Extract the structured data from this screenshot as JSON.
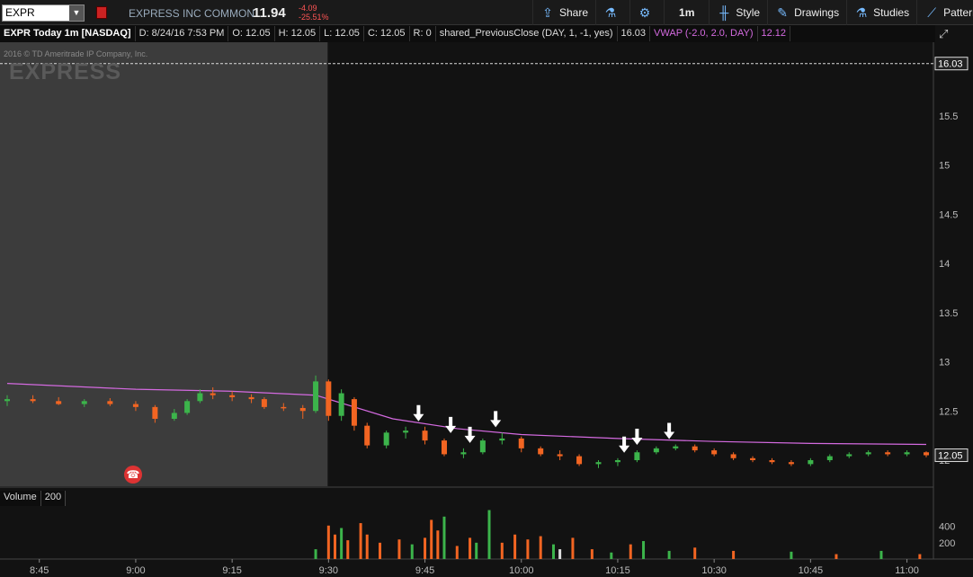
{
  "toolbar": {
    "symbol": "EXPR",
    "description": "EXPRESS INC COMMON",
    "last": "11.94",
    "net_change": "-4.09",
    "pct_change": "-25.51%",
    "buttons": [
      "Share",
      "",
      "1m",
      "Style",
      "Drawings",
      "Studies",
      "Patterns"
    ]
  },
  "infobar": {
    "title": "EXPR Today 1m [NASDAQ]",
    "date": "D: 8/24/16 7:53 PM",
    "open": "O: 12.05",
    "high": "H: 12.05",
    "low": "L: 12.05",
    "close": "C: 12.05",
    "r": "R: 0",
    "prev_close_study": "shared_PreviousClose (DAY, 1, -1, yes)",
    "prev_close_value": "16.03",
    "vwap_study": "VWAP (-2.0, 2.0, DAY)",
    "vwap_value": "12.12"
  },
  "copyright": "2016 © TD Ameritrade IP Company, Inc.",
  "watermark": "EXPRESS",
  "volume": {
    "label": "Volume",
    "value": "200"
  },
  "colors": {
    "up": "#3cb44b",
    "down": "#f26522",
    "vwap": "#d46ae0",
    "premarket_bg": "#3c3c3c",
    "bg": "#121212"
  },
  "chart_data": {
    "type": "candlestick",
    "x_ticks": [
      "8:45",
      "9:00",
      "9:15",
      "9:30",
      "9:45",
      "10:00",
      "10:15",
      "10:30",
      "10:45",
      "11:00"
    ],
    "y_ticks": [
      12,
      12.5,
      13,
      13.5,
      14,
      14.5,
      15,
      15.5,
      16
    ],
    "price_labels": {
      "prev_close": "16.03",
      "last": "12.05"
    },
    "volume_ticks": [
      200,
      400
    ],
    "candles": [
      {
        "t": "8:40",
        "o": 12.6,
        "h": 12.66,
        "l": 12.55,
        "c": 12.62
      },
      {
        "t": "8:44",
        "o": 12.62,
        "h": 12.66,
        "l": 12.58,
        "c": 12.6
      },
      {
        "t": "8:48",
        "o": 12.6,
        "h": 12.64,
        "l": 12.56,
        "c": 12.57
      },
      {
        "t": "8:52",
        "o": 12.57,
        "h": 12.62,
        "l": 12.54,
        "c": 12.6
      },
      {
        "t": "8:56",
        "o": 12.6,
        "h": 12.63,
        "l": 12.55,
        "c": 12.57
      },
      {
        "t": "9:00",
        "o": 12.57,
        "h": 12.6,
        "l": 12.5,
        "c": 12.54
      },
      {
        "t": "9:03",
        "o": 12.54,
        "h": 12.56,
        "l": 12.38,
        "c": 12.42
      },
      {
        "t": "9:06",
        "o": 12.42,
        "h": 12.52,
        "l": 12.4,
        "c": 12.48
      },
      {
        "t": "9:08",
        "o": 12.48,
        "h": 12.62,
        "l": 12.46,
        "c": 12.6
      },
      {
        "t": "9:10",
        "o": 12.6,
        "h": 12.72,
        "l": 12.58,
        "c": 12.68
      },
      {
        "t": "9:12",
        "o": 12.68,
        "h": 12.74,
        "l": 12.62,
        "c": 12.66
      },
      {
        "t": "9:15",
        "o": 12.66,
        "h": 12.7,
        "l": 12.6,
        "c": 12.64
      },
      {
        "t": "9:18",
        "o": 12.64,
        "h": 12.67,
        "l": 12.58,
        "c": 12.62
      },
      {
        "t": "9:20",
        "o": 12.62,
        "h": 12.64,
        "l": 12.52,
        "c": 12.54
      },
      {
        "t": "9:23",
        "o": 12.54,
        "h": 12.58,
        "l": 12.5,
        "c": 12.53
      },
      {
        "t": "9:26",
        "o": 12.53,
        "h": 12.56,
        "l": 12.42,
        "c": 12.5
      },
      {
        "t": "9:28",
        "o": 12.5,
        "h": 12.86,
        "l": 12.48,
        "c": 12.8
      },
      {
        "t": "9:30",
        "o": 12.8,
        "h": 12.82,
        "l": 12.4,
        "c": 12.45
      },
      {
        "t": "9:32",
        "o": 12.45,
        "h": 12.72,
        "l": 12.4,
        "c": 12.68
      },
      {
        "t": "9:34",
        "o": 12.62,
        "h": 12.64,
        "l": 12.3,
        "c": 12.35
      },
      {
        "t": "9:36",
        "o": 12.35,
        "h": 12.38,
        "l": 12.12,
        "c": 12.15
      },
      {
        "t": "9:39",
        "o": 12.15,
        "h": 12.3,
        "l": 12.12,
        "c": 12.28
      },
      {
        "t": "9:42",
        "o": 12.28,
        "h": 12.34,
        "l": 12.22,
        "c": 12.3
      },
      {
        "t": "9:45",
        "o": 12.3,
        "h": 12.34,
        "l": 12.16,
        "c": 12.2
      },
      {
        "t": "9:48",
        "o": 12.2,
        "h": 12.22,
        "l": 12.04,
        "c": 12.06
      },
      {
        "t": "9:51",
        "o": 12.06,
        "h": 12.12,
        "l": 12.02,
        "c": 12.08
      },
      {
        "t": "9:54",
        "o": 12.08,
        "h": 12.22,
        "l": 12.06,
        "c": 12.2
      },
      {
        "t": "9:57",
        "o": 12.2,
        "h": 12.28,
        "l": 12.16,
        "c": 12.22
      },
      {
        "t": "10:00",
        "o": 12.22,
        "h": 12.24,
        "l": 12.08,
        "c": 12.12
      },
      {
        "t": "10:03",
        "o": 12.12,
        "h": 12.14,
        "l": 12.04,
        "c": 12.06
      },
      {
        "t": "10:06",
        "o": 12.06,
        "h": 12.1,
        "l": 12.0,
        "c": 12.04
      },
      {
        "t": "10:09",
        "o": 12.04,
        "h": 12.06,
        "l": 11.94,
        "c": 11.96
      },
      {
        "t": "10:12",
        "o": 11.96,
        "h": 12.0,
        "l": 11.92,
        "c": 11.98
      },
      {
        "t": "10:15",
        "o": 11.98,
        "h": 12.02,
        "l": 11.94,
        "c": 12.0
      },
      {
        "t": "10:18",
        "o": 12.0,
        "h": 12.1,
        "l": 11.98,
        "c": 12.08
      },
      {
        "t": "10:21",
        "o": 12.08,
        "h": 12.14,
        "l": 12.06,
        "c": 12.12
      },
      {
        "t": "10:24",
        "o": 12.12,
        "h": 12.16,
        "l": 12.1,
        "c": 12.14
      },
      {
        "t": "10:27",
        "o": 12.14,
        "h": 12.16,
        "l": 12.08,
        "c": 12.1
      },
      {
        "t": "10:30",
        "o": 12.1,
        "h": 12.12,
        "l": 12.04,
        "c": 12.06
      },
      {
        "t": "10:33",
        "o": 12.06,
        "h": 12.08,
        "l": 12.0,
        "c": 12.02
      },
      {
        "t": "10:36",
        "o": 12.02,
        "h": 12.04,
        "l": 11.98,
        "c": 12.0
      },
      {
        "t": "10:39",
        "o": 12.0,
        "h": 12.02,
        "l": 11.96,
        "c": 11.98
      },
      {
        "t": "10:42",
        "o": 11.98,
        "h": 12.0,
        "l": 11.94,
        "c": 11.96
      },
      {
        "t": "10:45",
        "o": 11.96,
        "h": 12.02,
        "l": 11.94,
        "c": 12.0
      },
      {
        "t": "10:48",
        "o": 12.0,
        "h": 12.06,
        "l": 11.98,
        "c": 12.04
      },
      {
        "t": "10:51",
        "o": 12.04,
        "h": 12.08,
        "l": 12.02,
        "c": 12.06
      },
      {
        "t": "10:54",
        "o": 12.06,
        "h": 12.1,
        "l": 12.04,
        "c": 12.08
      },
      {
        "t": "10:57",
        "o": 12.08,
        "h": 12.1,
        "l": 12.04,
        "c": 12.06
      },
      {
        "t": "11:00",
        "o": 12.06,
        "h": 12.1,
        "l": 12.04,
        "c": 12.08
      },
      {
        "t": "11:03",
        "o": 12.08,
        "h": 12.09,
        "l": 12.03,
        "c": 12.05
      }
    ],
    "vwap": [
      {
        "t": "8:40",
        "v": 12.78
      },
      {
        "t": "9:00",
        "v": 12.72
      },
      {
        "t": "9:15",
        "v": 12.7
      },
      {
        "t": "9:28",
        "v": 12.66
      },
      {
        "t": "9:32",
        "v": 12.58
      },
      {
        "t": "9:40",
        "v": 12.42
      },
      {
        "t": "9:50",
        "v": 12.32
      },
      {
        "t": "10:00",
        "v": 12.26
      },
      {
        "t": "10:15",
        "v": 12.22
      },
      {
        "t": "10:30",
        "v": 12.19
      },
      {
        "t": "10:45",
        "v": 12.17
      },
      {
        "t": "11:03",
        "v": 12.16
      }
    ],
    "arrows": [
      "9:44",
      "9:49",
      "9:52",
      "9:56",
      "10:16",
      "10:18",
      "10:23"
    ],
    "volume_bars": [
      {
        "t": "9:28",
        "v": 120,
        "c": "up"
      },
      {
        "t": "9:30",
        "v": 410,
        "c": "down"
      },
      {
        "t": "9:31",
        "v": 300,
        "c": "down"
      },
      {
        "t": "9:32",
        "v": 380,
        "c": "up"
      },
      {
        "t": "9:33",
        "v": 230,
        "c": "down"
      },
      {
        "t": "9:35",
        "v": 440,
        "c": "down"
      },
      {
        "t": "9:36",
        "v": 300,
        "c": "down"
      },
      {
        "t": "9:38",
        "v": 200,
        "c": "down"
      },
      {
        "t": "9:41",
        "v": 240,
        "c": "down"
      },
      {
        "t": "9:43",
        "v": 180,
        "c": "up"
      },
      {
        "t": "9:45",
        "v": 260,
        "c": "down"
      },
      {
        "t": "9:46",
        "v": 480,
        "c": "down"
      },
      {
        "t": "9:47",
        "v": 350,
        "c": "down"
      },
      {
        "t": "9:48",
        "v": 520,
        "c": "up"
      },
      {
        "t": "9:50",
        "v": 160,
        "c": "down"
      },
      {
        "t": "9:52",
        "v": 260,
        "c": "down"
      },
      {
        "t": "9:53",
        "v": 200,
        "c": "up"
      },
      {
        "t": "9:55",
        "v": 600,
        "c": "up"
      },
      {
        "t": "9:57",
        "v": 200,
        "c": "down"
      },
      {
        "t": "9:59",
        "v": 300,
        "c": "down"
      },
      {
        "t": "10:01",
        "v": 240,
        "c": "down"
      },
      {
        "t": "10:03",
        "v": 280,
        "c": "down"
      },
      {
        "t": "10:05",
        "v": 180,
        "c": "up"
      },
      {
        "t": "10:06",
        "v": 120,
        "c": "neutral"
      },
      {
        "t": "10:08",
        "v": 260,
        "c": "down"
      },
      {
        "t": "10:11",
        "v": 120,
        "c": "down"
      },
      {
        "t": "10:14",
        "v": 80,
        "c": "up"
      },
      {
        "t": "10:17",
        "v": 180,
        "c": "down"
      },
      {
        "t": "10:19",
        "v": 220,
        "c": "up"
      },
      {
        "t": "10:23",
        "v": 100,
        "c": "up"
      },
      {
        "t": "10:27",
        "v": 140,
        "c": "down"
      },
      {
        "t": "10:33",
        "v": 100,
        "c": "down"
      },
      {
        "t": "10:42",
        "v": 90,
        "c": "up"
      },
      {
        "t": "10:49",
        "v": 60,
        "c": "down"
      },
      {
        "t": "10:56",
        "v": 100,
        "c": "up"
      },
      {
        "t": "11:02",
        "v": 60,
        "c": "down"
      }
    ]
  }
}
